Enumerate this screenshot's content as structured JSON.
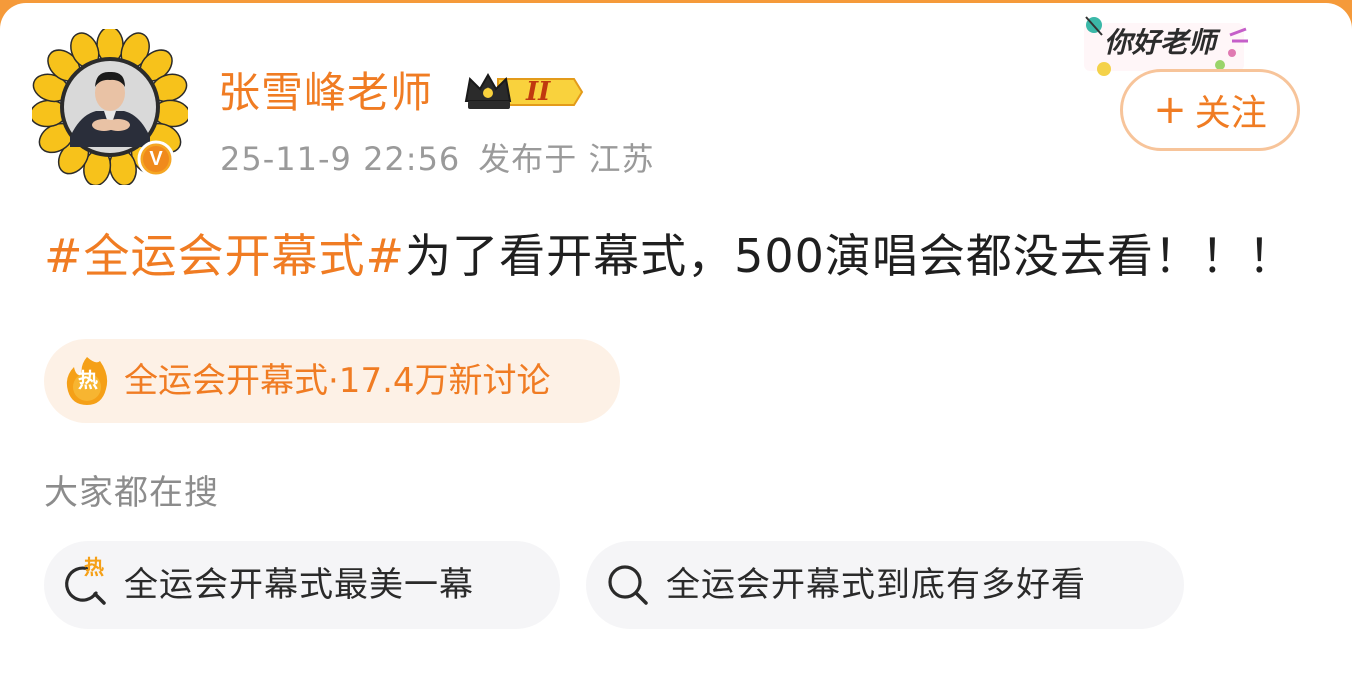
{
  "user": {
    "name": "张雪峰老师",
    "crown_level": "II",
    "verified_mark": "V",
    "timestamp": "25-11-9 22:56",
    "location": "发布于 江苏"
  },
  "sticker": {
    "text": "你好老师"
  },
  "follow": {
    "label": "关注",
    "plus": "+"
  },
  "post": {
    "hashtag": "#全运会开幕式#",
    "body": "为了看开幕式，500演唱会都没去看！！！"
  },
  "topic": {
    "badge": "热",
    "label": "全运会开幕式·17.4万新讨论"
  },
  "search": {
    "title": "大家都在搜",
    "items": [
      {
        "label": "全运会开幕式最美一幕",
        "icon": "hot-search-icon",
        "badge": "热"
      },
      {
        "label": "全运会开幕式到底有多好看",
        "icon": "search-icon"
      }
    ]
  },
  "colors": {
    "accent": "#f07c23",
    "topbar": "#f59a3a",
    "pill_bg": "#fdf1e6",
    "chip_bg": "#f5f5f7",
    "meta": "#9a9a9a"
  }
}
